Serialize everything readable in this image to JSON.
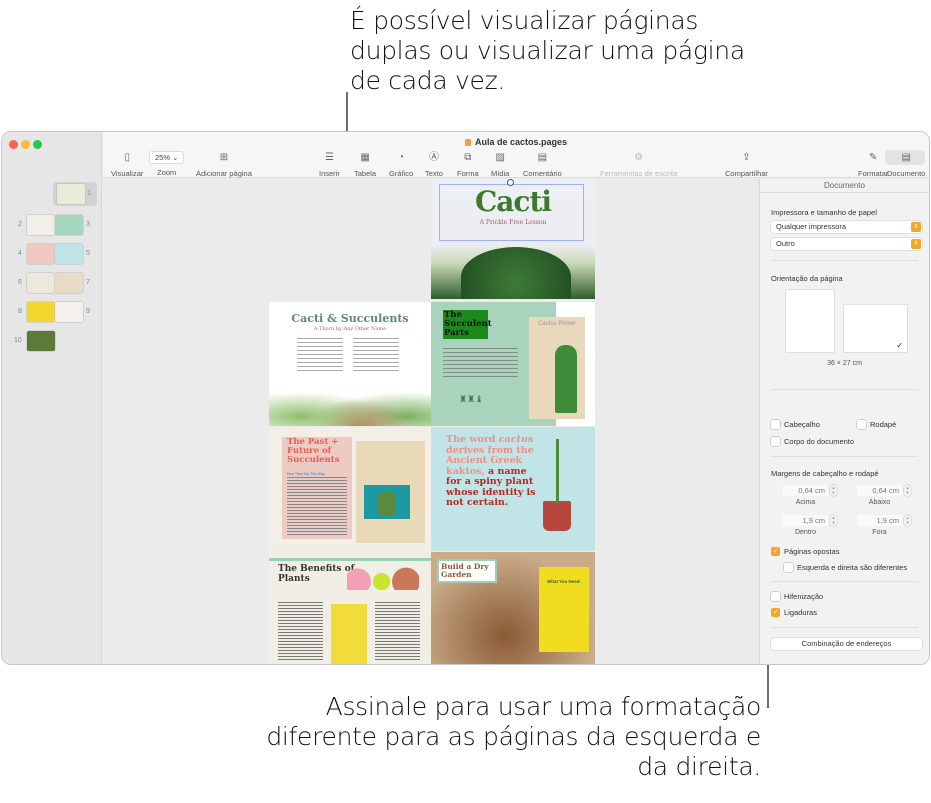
{
  "callouts": {
    "top": "É possível visualizar páginas duplas ou visualizar uma página de cada vez.",
    "bottom": "Assinale para usar uma formatação diferente para as páginas da esquerda e da direita."
  },
  "window": {
    "title": "Aula de cactos.pages",
    "toolbar": {
      "view": "Visualizar",
      "zoom_value": "25%",
      "zoom": "Zoom",
      "add_page": "Adicionar página",
      "insert": "Inserir",
      "table": "Tabela",
      "chart": "Gráfico",
      "text": "Texto",
      "shape": "Forma",
      "media": "Mídia",
      "comment": "Comentário",
      "writing_tools": "Ferramentas de escrita",
      "share": "Compartilhar",
      "format": "Formatar",
      "document": "Documento"
    }
  },
  "thumbnails": [
    {
      "num": "1",
      "color": "#e8ecd8",
      "selected": true
    },
    {
      "num": "2",
      "color": "#f1efe8"
    },
    {
      "num": "3",
      "color": "#a8d5c0"
    },
    {
      "num": "4",
      "color": "#f0c8c0"
    },
    {
      "num": "5",
      "color": "#bfe3e6"
    },
    {
      "num": "6",
      "color": "#ece8dc"
    },
    {
      "num": "7",
      "color": "#e8dcc8"
    },
    {
      "num": "8",
      "color": "#f2d62a"
    },
    {
      "num": "9",
      "color": "#f4f0ec"
    },
    {
      "num": "10",
      "color": "#5d7a3a"
    }
  ],
  "pages": {
    "cover": {
      "title": "Cacti",
      "subtitle": "A Prickle Free Lesson"
    },
    "p2": {
      "title": "Cacti & Succulents",
      "subtitle": "A Thorn by Any Other Name"
    },
    "p3": {
      "title": "The Succulent Parts",
      "card": "Cactus Primer"
    },
    "p4": {
      "title": "The Past + Future of Succulents",
      "sub": "How They Got This Way"
    },
    "p5": {
      "l1": "The word",
      "l2": "cactus",
      "l3": "derives from the Ancient Greek kaktos,",
      "l4": "a name for a spiny plant whose identity is not certain."
    },
    "p6": {
      "title": "The Benefits of Plants"
    },
    "p7": {
      "title": "Build a Dry Garden",
      "card": "What You Need:"
    }
  },
  "inspector": {
    "tab": "Documento",
    "printer_section": "Impressora e tamanho de papel",
    "printer": "Qualquer impressora",
    "paper": "Outro",
    "orientation_section": "Orientação da página",
    "orientation_selected": "landscape",
    "page_size": "36 × 27 cm",
    "header": {
      "label": "Cabeçalho",
      "checked": false
    },
    "footer": {
      "label": "Rodapé",
      "checked": false
    },
    "body": {
      "label": "Corpo do documento",
      "checked": false
    },
    "margins_section": "Margens de cabeçalho e rodapé",
    "top": {
      "value": "0,64 cm",
      "label": "Acima"
    },
    "bottom": {
      "value": "0,64 cm",
      "label": "Abaixo"
    },
    "inside": {
      "value": "1,9 cm",
      "label": "Dentro"
    },
    "outside": {
      "value": "1,9 cm",
      "label": "Fora"
    },
    "facing_pages": {
      "label": "Páginas opostas",
      "checked": true
    },
    "left_right_different": {
      "label": "Esquerda e direita são diferentes",
      "checked": false
    },
    "hyphenation": {
      "label": "Hifenização",
      "checked": false
    },
    "ligatures": {
      "label": "Ligaduras",
      "checked": true
    },
    "mail_merge": "Combinação de endereços"
  }
}
